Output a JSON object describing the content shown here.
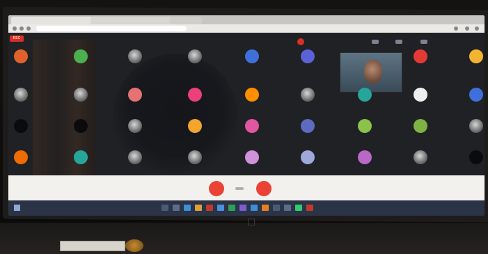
{
  "scene": {
    "description_colors": {
      "meeting_background": "#202124",
      "control_bar": "#f3f1ee",
      "taskbar": "#2b3446",
      "accent_red": "#ea4335"
    }
  },
  "browser": {
    "tabs": [
      {
        "label": "",
        "icon": "meet-tab-icon"
      },
      {
        "label": "",
        "icon": "google-tab-icon"
      },
      {
        "label": "",
        "icon": "new-tab-icon"
      }
    ],
    "address": ""
  },
  "meeting": {
    "rec_label": "REC",
    "caller_name": "",
    "self_label": "",
    "time": "",
    "avatars": [
      {
        "color": "#e0622b"
      },
      {
        "color": "#4caf50"
      },
      {
        "color": "photo"
      },
      {
        "color": "photo"
      },
      {
        "color": "#3f6fd9"
      },
      {
        "color": "#5b62d6"
      },
      {
        "color": "#e53935"
      },
      {
        "color": "#f2b531"
      },
      {
        "color": "photo"
      },
      {
        "color": "photo"
      },
      {
        "color": "#e57373"
      },
      {
        "color": "#ec407a"
      },
      {
        "color": "#ff8f00"
      },
      {
        "color": "photo"
      },
      {
        "color": "#26a69a"
      },
      {
        "color": "#eeeeee"
      },
      {
        "color": "#3f6fd9"
      },
      {
        "color": "dark"
      },
      {
        "color": "dark"
      },
      {
        "color": "photo"
      },
      {
        "color": "#f4a52c"
      },
      {
        "color": "#e056a0"
      },
      {
        "color": "#5c6bc0"
      },
      {
        "color": "#8bc34a"
      },
      {
        "color": "#7cb342"
      },
      {
        "color": "photo"
      },
      {
        "color": "#ef6c00"
      },
      {
        "color": "#26a69a"
      },
      {
        "color": "photo"
      },
      {
        "color": "photo"
      },
      {
        "color": "#ce93d8"
      },
      {
        "color": "#9fa8da"
      },
      {
        "color": "#ba68c8"
      },
      {
        "color": "photo"
      },
      {
        "color": "dark"
      }
    ]
  },
  "controls": {
    "meeting_details": "",
    "present_label": "",
    "captions_label": ""
  },
  "taskbar": {
    "tray": ""
  },
  "sticker": {
    "text": ""
  }
}
